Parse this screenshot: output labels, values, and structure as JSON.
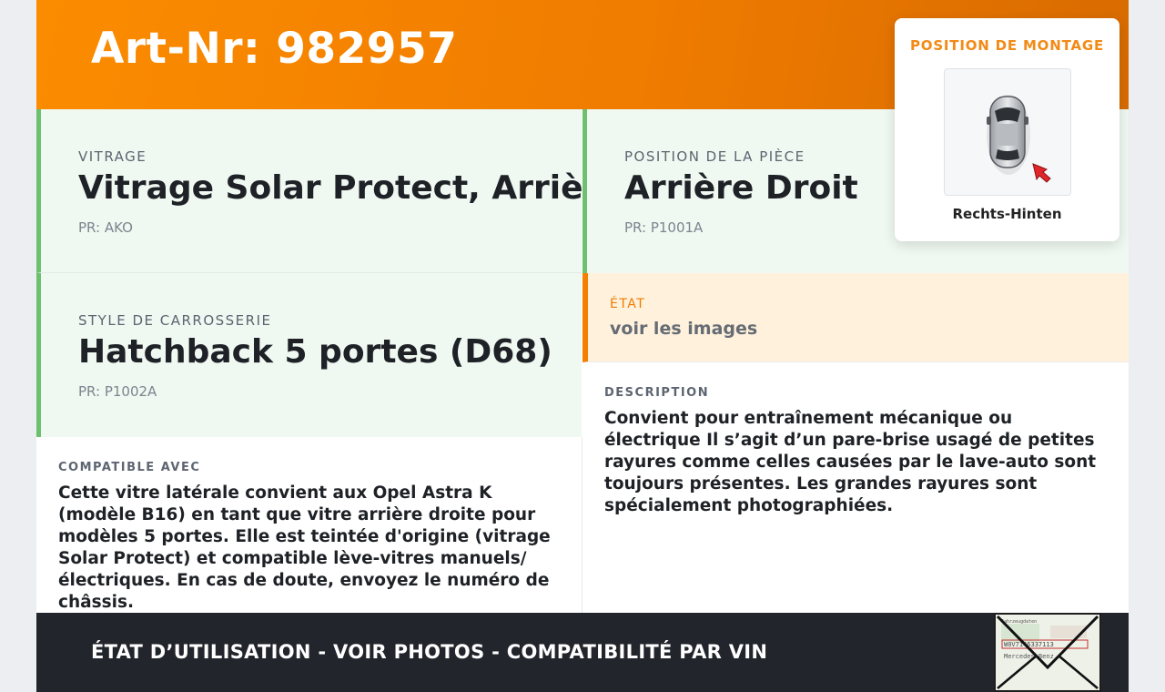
{
  "header": {
    "title": "Art-Nr: 982957"
  },
  "vitrage": {
    "label": "VITRAGE",
    "value": "Vitrage Solar Protect, Arrière",
    "pr": "PR: AKO"
  },
  "position": {
    "label": "POSITION DE LA PIÈCE",
    "value": "Arrière Droit",
    "pr": "PR: P1001A"
  },
  "style": {
    "label": "STYLE DE CARROSSERIE",
    "value": "Hatchback 5 portes (D68)",
    "pr": "PR: P1002A"
  },
  "etat": {
    "label": "ÉTAT",
    "value": "voir les images"
  },
  "compatible": {
    "label": "COMPATIBLE AVEC",
    "text": "Cette vitre latérale convient aux Opel Astra K (modèle B16) en tant que vitre arrière droite pour modèles 5 portes. Elle est teintée d'origine (vitrage Solar Protect) et compatible lève-vitres manuels/électriques. En cas de doute, envoyez le numéro de châssis."
  },
  "description": {
    "label": "DESCRIPTION",
    "text": "Convient pour entraînement mécanique ou électrique Il s’agit d’un pare-brise usagé de petites rayures comme celles causées par le lave-auto sont toujours présentes. Les grandes rayures sont spécialement photographiées."
  },
  "montage": {
    "title": "POSITION DE MONTAGE",
    "caption": "Rechts-Hinten",
    "icon": "car-top-view-arrow-icon"
  },
  "footer": {
    "text": "ÉTAT D’UTILISATION - VOIR PHOTOS - COMPATIBILITÉ PAR VIN"
  },
  "stamp": {
    "icon": "envelope-document-icon",
    "line1": "Fahrzeugdaten",
    "line2": "W0V7146337113",
    "line3": "Mercedes-Benz"
  },
  "colors": {
    "accent": "#f57f00",
    "green_border": "#6cc070",
    "footer_bg": "#22252b",
    "etat_bg": "#fff1dc"
  }
}
